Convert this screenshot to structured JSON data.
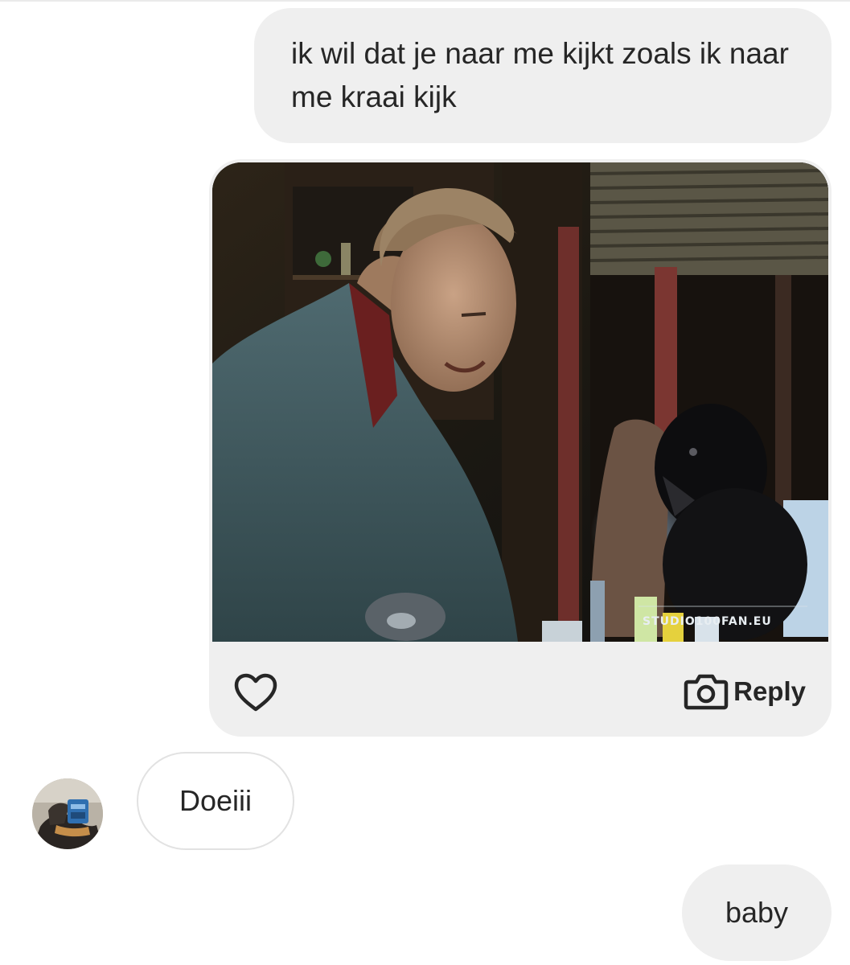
{
  "thread": {
    "messages": {
      "sent_text": "ik wil dat je naar me kijkt zoals ik naar me kraai kijk",
      "shared_image": {
        "watermark": "STUDIO100FAN.EU",
        "like_icon": "heart-icon",
        "reply_icon": "camera-icon",
        "reply_label": "Reply"
      },
      "received_text": "Doeiii",
      "sent_final": "baby"
    }
  },
  "colors": {
    "sent_bubble": "#efefef",
    "received_border": "#e2e2e2",
    "text": "#262626"
  }
}
